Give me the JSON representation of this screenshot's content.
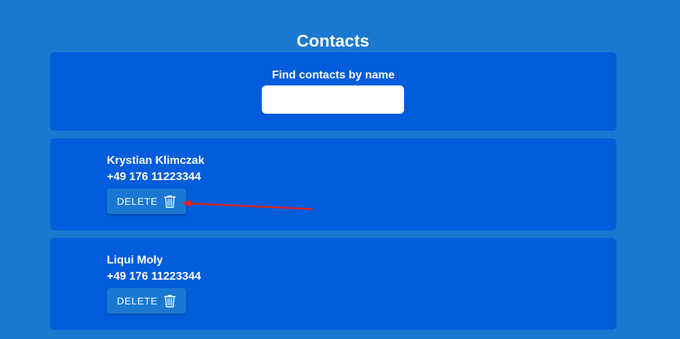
{
  "page": {
    "title": "Contacts"
  },
  "search": {
    "label": "Find contacts by name",
    "value": ""
  },
  "contacts": [
    {
      "name": "Krystian Klimczak",
      "phone": "+49 176 11223344",
      "delete_label": "DELETE"
    },
    {
      "name": "Liqui Moly",
      "phone": "+49 176 11223344",
      "delete_label": "DELETE"
    }
  ],
  "colors": {
    "background": "#1b78d0",
    "card": "#015ddb",
    "button": "#1a78d3",
    "annotation_arrow": "#e0201a"
  },
  "icons": {
    "delete": "trash-icon"
  }
}
